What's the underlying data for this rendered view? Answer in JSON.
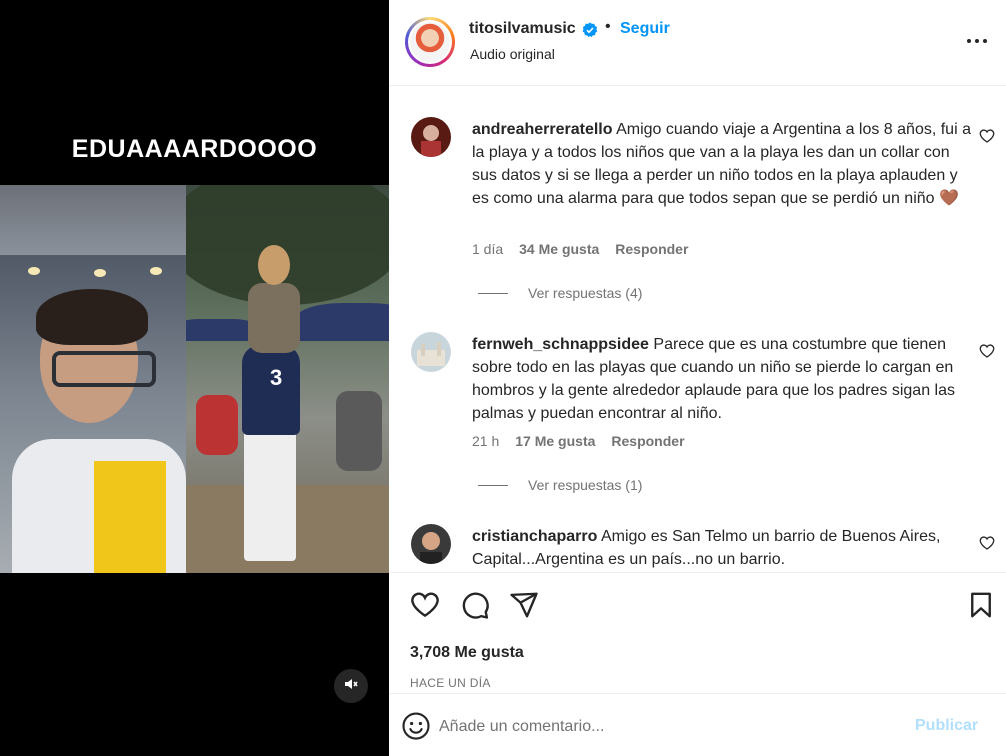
{
  "media": {
    "caption": "EDUAAAARDOOOO",
    "jersey_number": "3",
    "mute_icon": "speaker-muted-icon"
  },
  "header": {
    "username": "titosilvamusic",
    "separator": "•",
    "follow_label": "Seguir",
    "audio_label": "Audio original",
    "more_icon": "more-horizontal-icon"
  },
  "comments": [
    {
      "user": "andreaherreratello",
      "text": "Amigo cuando viaje a Argentina a los 8 años, fui a la playa y a todos los niños que van a la playa les dan un collar con sus datos y si se llega a perder un niño todos en la playa aplauden y es como una alarma para que todos sepan que se perdió un niño 🤎",
      "time": "1 día",
      "likes": "34 Me gusta",
      "reply_label": "Responder",
      "view_replies": "Ver respuestas (4)"
    },
    {
      "user": "fernweh_schnappsidee",
      "text": "Parece que es una costumbre que tienen sobre todo en las playas que cuando un niño se pierde lo cargan en hombros y la gente alrededor aplaude para que los padres sigan las palmas y puedan encontrar al niño.",
      "time": "21 h",
      "likes": "17 Me gusta",
      "reply_label": "Responder",
      "view_replies": "Ver respuestas (1)"
    },
    {
      "user": "cristianchaparro",
      "text": "Amigo es San Telmo un barrio de Buenos Aires, Capital...Argentina es un país...no un barrio."
    }
  ],
  "footer": {
    "likes_count": "3,708 Me gusta",
    "timestamp": "HACE UN DÍA",
    "comment_placeholder": "Añade un comentario...",
    "publish_label": "Publicar"
  },
  "colors": {
    "link_blue": "#0095f6",
    "publish_disabled": "#b2dffc",
    "secondary_text": "#737373"
  }
}
